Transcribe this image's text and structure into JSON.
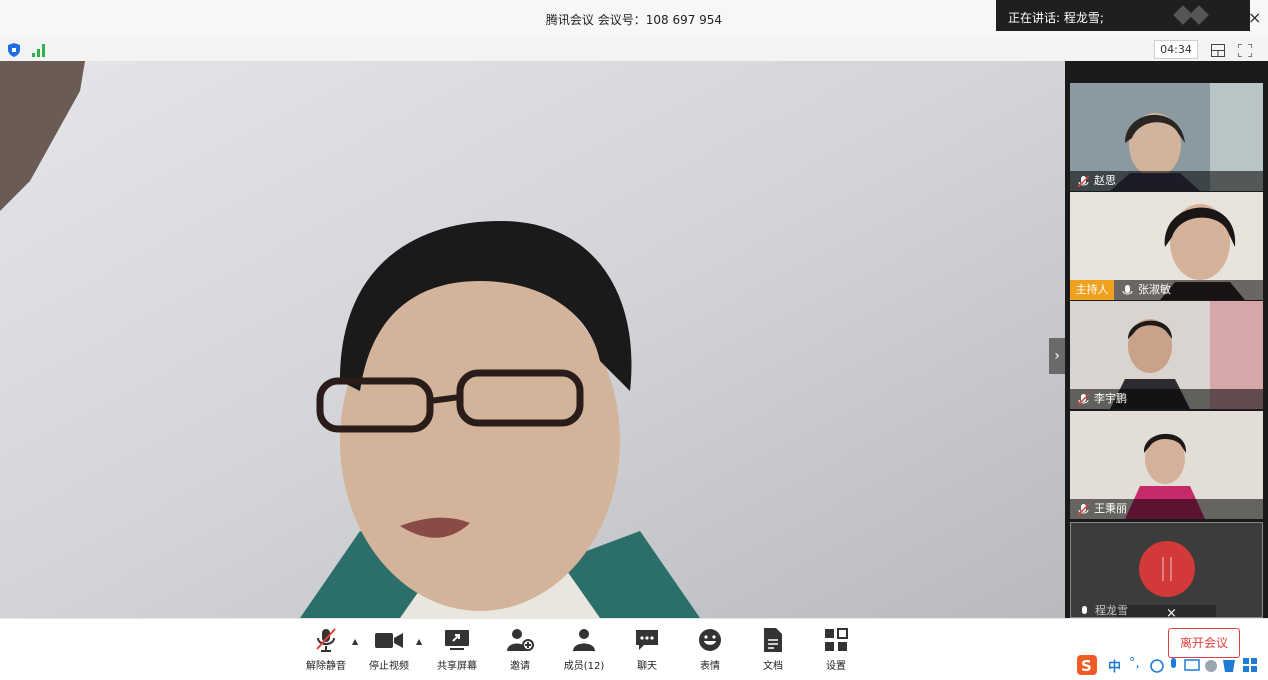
{
  "window": {
    "title": "腾讯会议 会议号：108 697 954",
    "speaking_text": "正在讲话: 程龙雪;",
    "close_glyph": "×"
  },
  "status": {
    "timer": "04:34",
    "icons": [
      "shield-icon",
      "signal-icon",
      "layout-icon",
      "fullscreen-icon"
    ]
  },
  "participants": [
    {
      "name": "赵思",
      "muted": true,
      "host": false
    },
    {
      "name": "张淑敏",
      "muted": false,
      "host": true,
      "host_label": "主持人"
    },
    {
      "name": "李宇鹏",
      "muted": true,
      "host": false
    },
    {
      "name": "王秉丽",
      "muted": true,
      "host": false
    },
    {
      "name": "程龙雪",
      "muted": false,
      "host": false
    }
  ],
  "toolbar": {
    "unmute": "解除静音",
    "stop_video": "停止视频",
    "share": "共享屏幕",
    "invite": "邀请",
    "members": "成员(12)",
    "chat": "聊天",
    "emoji": "表情",
    "docs": "文档",
    "settings": "设置",
    "leave": "离开会议"
  },
  "ime": {
    "mode": "中",
    "punct": "°,"
  },
  "colors": {
    "accent": "#e0413b",
    "host_badge": "#f0a11f",
    "side_bg": "#1a1a1a"
  }
}
